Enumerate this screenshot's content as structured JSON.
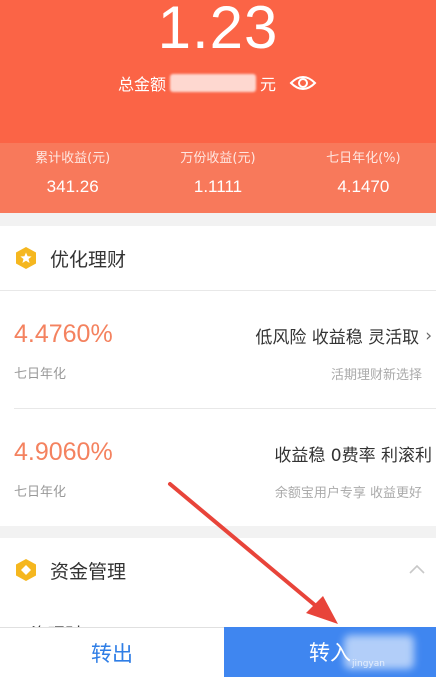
{
  "header": {
    "total_amount": "1.23",
    "total_label": "总金额",
    "total_unit": "元"
  },
  "stats": [
    {
      "label": "累计收益(元)",
      "value": "341.26"
    },
    {
      "label": "万份收益(元)",
      "value": "1.1111"
    },
    {
      "label": "七日年化(%)",
      "value": "4.1470"
    }
  ],
  "optimize_section": {
    "title": "优化理财",
    "products": [
      {
        "rate": "4.4760%",
        "rate_label": "七日年化",
        "tags": "低风险 收益稳 灵活取",
        "desc": "活期理财新选择"
      },
      {
        "rate": "4.9060%",
        "rate_label": "七日年化",
        "tags": "收益稳 0费率 利滚利",
        "desc": "余额宝用户专享 收益更好"
      }
    ]
  },
  "funds_section": {
    "title": "资金管理",
    "partial_item": "工资理财"
  },
  "bottom_bar": {
    "transfer_out": "转出",
    "transfer_in": "转入",
    "watermark": "jingyan"
  },
  "colors": {
    "hero": "#fb6446",
    "rate": "#f4825f",
    "badge": "#f5b71f",
    "primary_blue": "#3f86f0",
    "arrow": "#e8443a"
  },
  "icons": [
    "eye-icon",
    "star-badge-icon",
    "coin-badge-icon",
    "chevron-right-icon",
    "chevron-up-icon",
    "annotation-arrow"
  ]
}
